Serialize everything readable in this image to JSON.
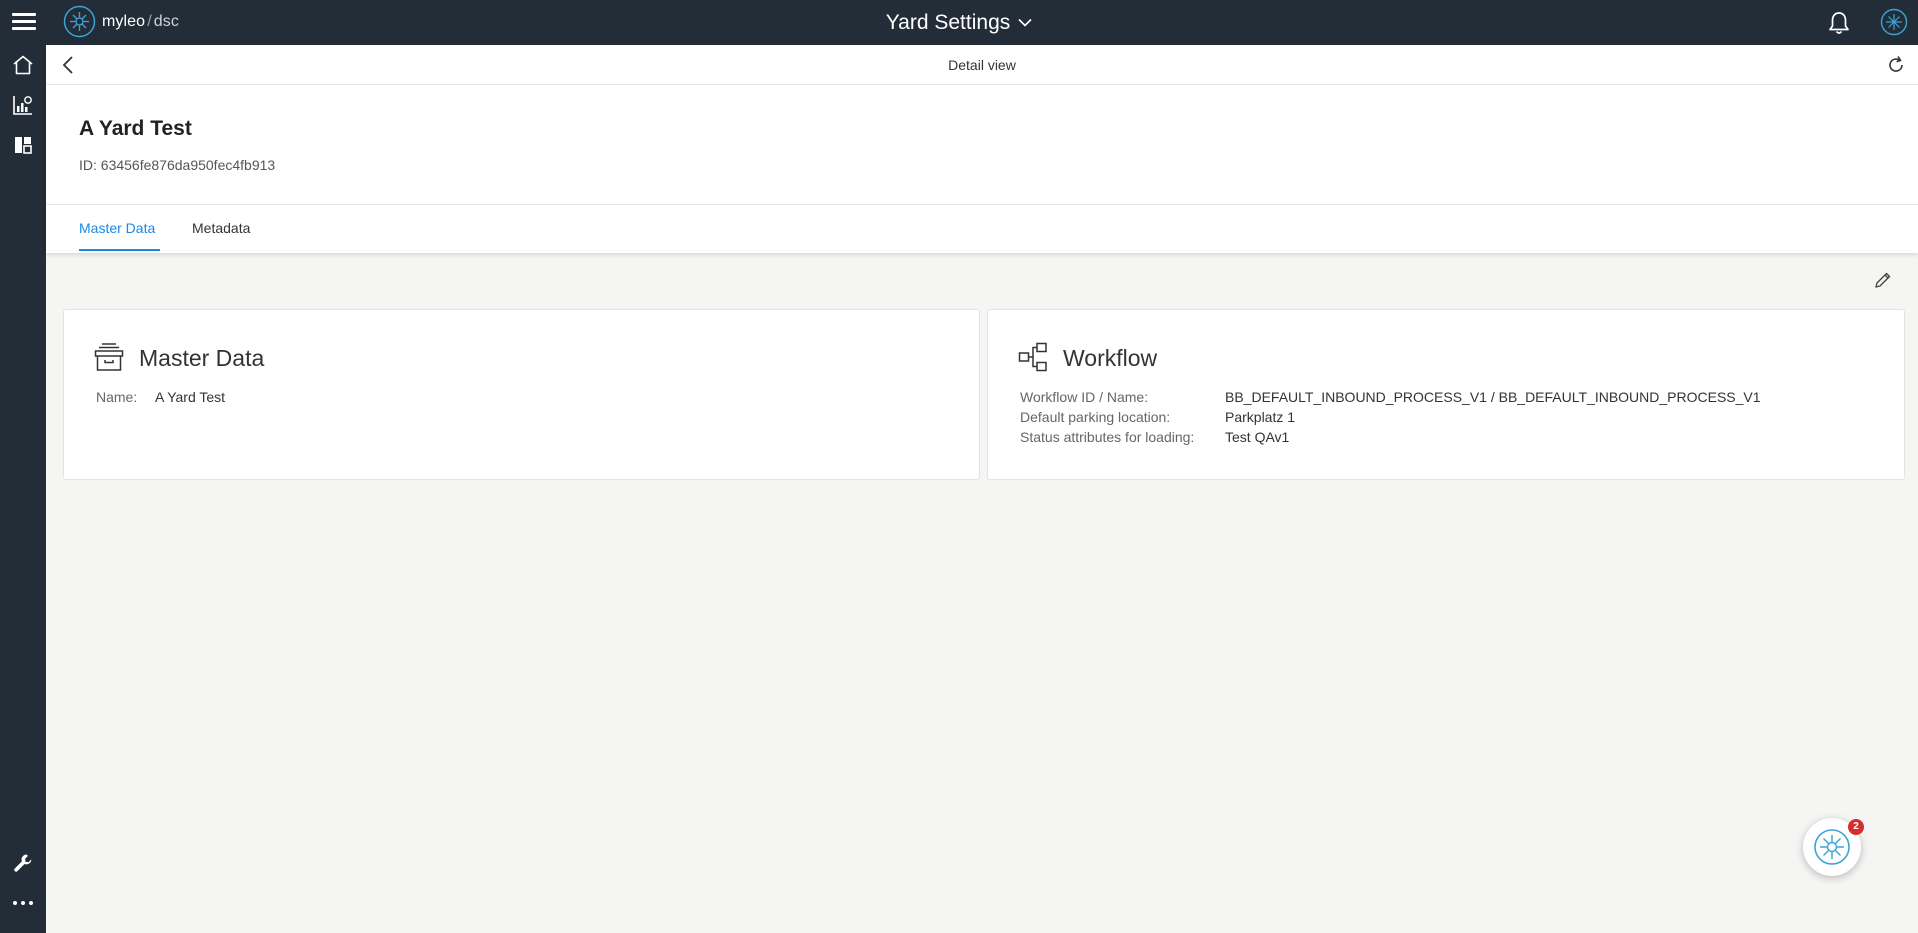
{
  "app": {
    "brand_name": "myleo",
    "brand_separator": "/",
    "brand_sub": "dsc",
    "page_title": "Yard Settings"
  },
  "sidebar": {
    "items": [
      {
        "name": "home",
        "icon": "home-icon"
      },
      {
        "name": "analytics",
        "icon": "chart-icon"
      },
      {
        "name": "dashboard",
        "icon": "dashboard-icon"
      },
      {
        "name": "tools",
        "icon": "wrench-icon"
      },
      {
        "name": "more",
        "icon": "more-dots-icon"
      }
    ]
  },
  "detail": {
    "view_label": "Detail view",
    "record_title": "A Yard Test",
    "record_id_label": "ID:",
    "record_id": "63456fe876da950fec4fb913"
  },
  "tabs": [
    {
      "label": "Master Data",
      "active": true
    },
    {
      "label": "Metadata",
      "active": false
    }
  ],
  "master_data_card": {
    "title": "Master Data",
    "fields": [
      {
        "label": "Name:",
        "value": "A Yard Test"
      }
    ]
  },
  "workflow_card": {
    "title": "Workflow",
    "fields": [
      {
        "label": "Workflow ID / Name:",
        "value": "BB_DEFAULT_INBOUND_PROCESS_V1 / BB_DEFAULT_INBOUND_PROCESS_V1"
      },
      {
        "label": "Default parking location:",
        "value": "Parkplatz 1"
      },
      {
        "label": "Status attributes for loading:",
        "value": "Test QAv1"
      }
    ]
  },
  "assistant": {
    "badge_count": "2"
  },
  "colors": {
    "topbar": "#232d38",
    "accent": "#1e88e5",
    "background": "#f5f5f4",
    "badge": "#d32f2f"
  }
}
